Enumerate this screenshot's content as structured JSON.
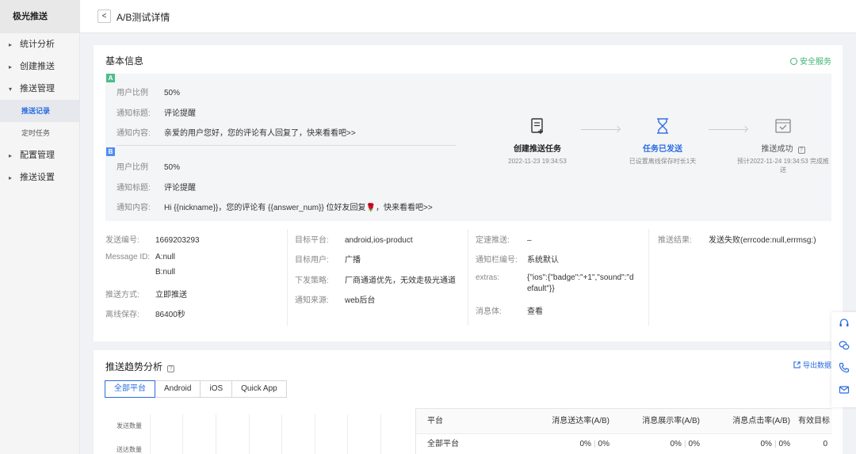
{
  "sidebar": {
    "brand": "极光推送",
    "items": [
      {
        "label": "统计分析",
        "caret": "▸"
      },
      {
        "label": "创建推送",
        "caret": "▸"
      },
      {
        "label": "推送管理",
        "caret": "▾"
      },
      {
        "label": "推送记录",
        "sub": true,
        "active": true
      },
      {
        "label": "定时任务",
        "sub": true
      },
      {
        "label": "配置管理",
        "caret": "▸"
      },
      {
        "label": "推送设置",
        "caret": "▸"
      }
    ]
  },
  "header": {
    "back": "<",
    "title": "A/B测试详情"
  },
  "basic": {
    "title": "基本信息",
    "safe": "安全服务",
    "a": {
      "badge": "A",
      "ratio_label": "用户比例",
      "ratio": "50%",
      "title_label": "通知标题:",
      "title": "评论提醒",
      "content_label": "通知内容:",
      "content": "亲爱的用户您好，您的评论有人回复了，快来看看吧>>"
    },
    "b": {
      "badge": "B",
      "ratio_label": "用户比例",
      "ratio": "50%",
      "title_label": "通知标题:",
      "title": "评论提醒",
      "content_label": "通知内容:",
      "content": "Hi {{nickname}}，您的评论有 {{answer_num}} 位好友回复🌹，快来看看吧>>"
    },
    "steps": [
      {
        "name": "创建推送任务",
        "sub": "2022-11-23 19:34:53"
      },
      {
        "name": "任务已发送",
        "sub": "已设置离线保存时长1天"
      },
      {
        "name": "推送成功",
        "qmark": "?",
        "sub": "预计2022-11-24 19:34:53 完成推送"
      }
    ],
    "fields": {
      "push_id_label": "发送编号:",
      "push_id": "1669203293",
      "msg_id_label": "Message ID:",
      "msg_id_a": "A:null",
      "msg_id_b": "B:null",
      "method_label": "推送方式:",
      "method": "立即推送",
      "offline_label": "离线保存:",
      "offline": "86400秒",
      "platform_label": "目标平台:",
      "platform": "android,ios-product",
      "target_label": "目标用户:",
      "target": "广播",
      "strategy_label": "下发策略:",
      "strategy": "厂商通道优先，无效走极光通道",
      "source_label": "通知来源:",
      "source": "web后台",
      "speed_label": "定速推送:",
      "speed": "–",
      "bar_label": "通知栏编号:",
      "bar": "系统默认",
      "extras_label": "extras:",
      "extras_1": "{\"ios\":{\"badge\":\"+1\",\"sound\":\"d",
      "extras_2": "efault\"}}",
      "body_label": "消息体:",
      "body": "查看",
      "result_label": "推送结果:",
      "result": "发送失败(errcode:null,errmsg:)"
    }
  },
  "trend": {
    "title": "推送趋势分析",
    "qmark": "?",
    "export": "导出数据",
    "tabs": [
      {
        "label": "全部平台",
        "active": true
      },
      {
        "label": "Android"
      },
      {
        "label": "iOS"
      },
      {
        "label": "Quick App"
      }
    ],
    "chart_ylabels": [
      "发送数量",
      "送达数量"
    ],
    "table": {
      "headers": [
        "平台",
        "消息送达率(A/B)",
        "消息展示率(A/B)",
        "消息点击率(A/B)",
        "有效目标"
      ],
      "rows": [
        {
          "platform": "全部平台",
          "c1a": "0%",
          "c1b": "0%",
          "c2a": "0%",
          "c2b": "0%",
          "c3a": "0%",
          "c3b": "0%",
          "c4": "0"
        }
      ]
    }
  }
}
